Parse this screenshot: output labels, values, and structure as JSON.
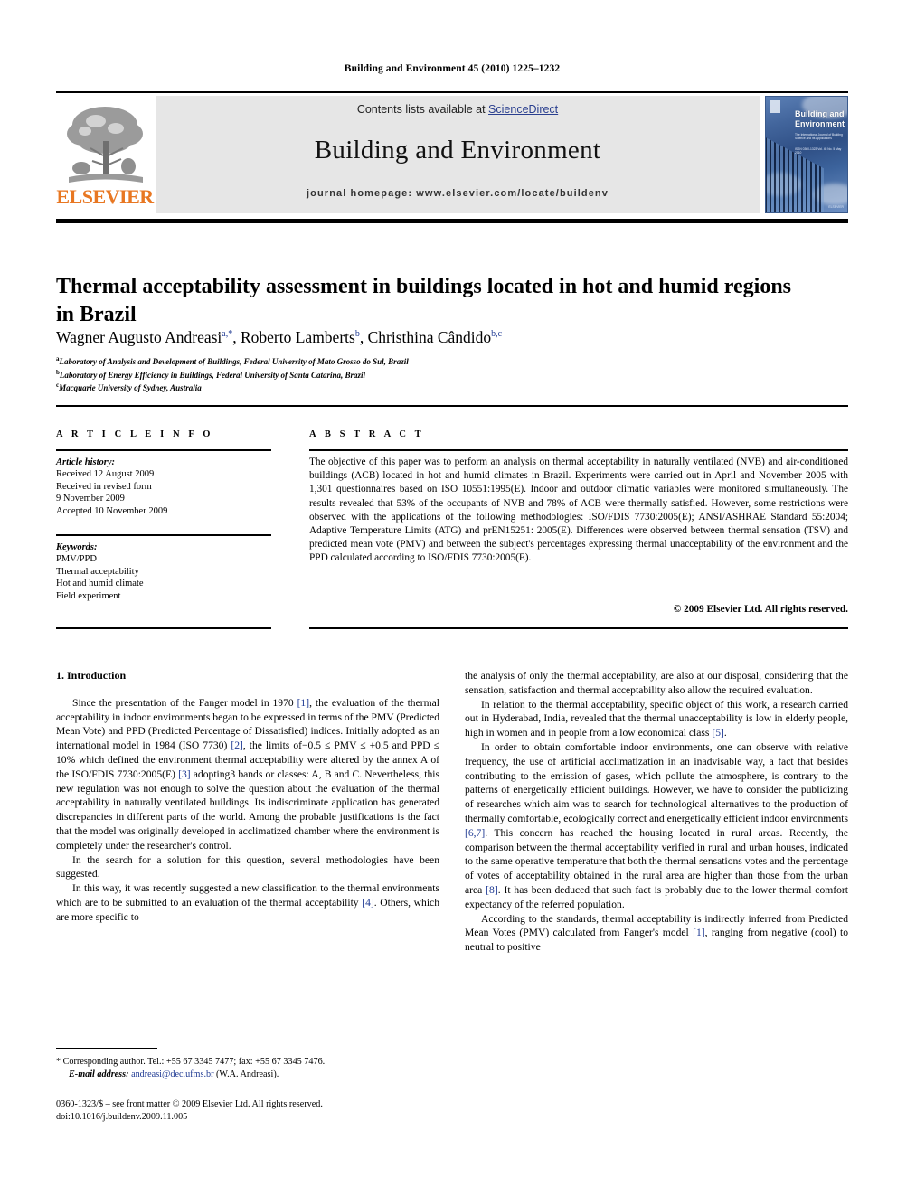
{
  "running_head": "Building and Environment 45 (2010) 1225–1232",
  "masthead": {
    "contents_prefix": "Contents lists available at ",
    "sciencedirect": "ScienceDirect",
    "journal_title": "Building and Environment",
    "homepage": "journal homepage: www.elsevier.com/locate/buildenv",
    "publisher": "ELSEVIER",
    "cover": {
      "title": "Building and Environment",
      "subtitle": "The International Journal of Building Science and its Applications",
      "issue_line": "ISSN 0360-1323  Vol. 45  No. 5  May 2010",
      "publisher": "ELSEVIER"
    }
  },
  "article": {
    "title": "Thermal acceptability assessment in buildings located in hot and humid regions in Brazil",
    "authors": [
      {
        "name": "Wagner Augusto Andreasi",
        "marks": "a,*"
      },
      {
        "name": "Roberto Lamberts",
        "marks": "b"
      },
      {
        "name": "Christhina Cândido",
        "marks": "b,c"
      }
    ],
    "affiliations": [
      {
        "mark": "a",
        "text": "Laboratory of Analysis and Development of Buildings, Federal University of Mato Grosso do Sul, Brazil"
      },
      {
        "mark": "b",
        "text": "Laboratory of Energy Efficiency in Buildings, Federal University of Santa Catarina, Brazil"
      },
      {
        "mark": "c",
        "text": "Macquarie University of Sydney, Australia"
      }
    ]
  },
  "info": {
    "label": "A R T I C L E   I N F O",
    "history_heading": "Article history:",
    "history": [
      "Received 12 August 2009",
      "Received in revised form",
      "9 November 2009",
      "Accepted 10 November 2009"
    ],
    "keywords_heading": "Keywords:",
    "keywords": [
      "PMV/PPD",
      "Thermal acceptability",
      "Hot and humid climate",
      "Field experiment"
    ]
  },
  "abstract": {
    "label": "A B S T R A C T",
    "text": "The objective of this paper was to perform an analysis on thermal acceptability in naturally ventilated (NVB) and air-conditioned buildings (ACB) located in hot and humid climates in Brazil. Experiments were carried out in April and November 2005 with 1,301 questionnaires based on ISO 10551:1995(E). Indoor and outdoor climatic variables were monitored simultaneously. The results revealed that 53% of the occupants of NVB and 78% of ACB were thermally satisfied. However, some restrictions were observed with the applications of the following methodologies: ISO/FDIS 7730:2005(E); ANSI/ASHRAE Standard 55:2004; Adaptive Temperature Limits (ATG) and prEN15251: 2005(E). Differences were observed between thermal sensation (TSV) and predicted mean vote (PMV) and between the subject's percentages expressing thermal unacceptability of the environment and the PPD calculated according to ISO/FDIS 7730:2005(E).",
    "copyright": "© 2009 Elsevier Ltd. All rights reserved."
  },
  "body": {
    "section_heading": "1. Introduction",
    "left_paragraphs": [
      "Since the presentation of the Fanger model in 1970 [1], the evaluation of the thermal acceptability in indoor environments began to be expressed in terms of the PMV (Predicted Mean Vote) and PPD (Predicted Percentage of Dissatisfied) indices. Initially adopted as an international model in 1984 (ISO 7730) [2], the limits of−0.5 ≤ PMV ≤ +0.5 and PPD ≤ 10% which defined the environment thermal acceptability were altered by the annex A of the ISO/FDIS 7730:2005(E) [3] adopting3 bands or classes: A, B and C. Nevertheless, this new regulation was not enough to solve the question about the evaluation of the thermal acceptability in naturally ventilated buildings. Its indiscriminate application has generated discrepancies in different parts of the world. Among the probable justifications is the fact that the model was originally developed in acclimatized chamber where the environment is completely under the researcher's control.",
      "In the search for a solution for this question, several methodologies have been suggested.",
      "In this way, it was recently suggested a new classification to the thermal environments which are to be submitted to an evaluation of the thermal acceptability [4]. Others, which are more specific to"
    ],
    "right_paragraphs": [
      "the analysis of only the thermal acceptability, are also at our disposal, considering that the sensation, satisfaction and thermal acceptability also allow the required evaluation.",
      "In relation to the thermal acceptability, specific object of this work, a research carried out in Hyderabad, India, revealed that the thermal unacceptability is low in elderly people, high in women and in people from a low economical class [5].",
      "In order to obtain comfortable indoor environments, one can observe with relative frequency, the use of artificial acclimatization in an inadvisable way, a fact that besides contributing to the emission of gases, which pollute the atmosphere, is contrary to the patterns of energetically efficient buildings. However, we have to consider the publicizing of researches which aim was to search for technological alternatives to the production of thermally comfortable, ecologically correct and energetically efficient indoor environments [6,7]. This concern has reached the housing located in rural areas. Recently, the comparison between the thermal acceptability verified in rural and urban houses, indicated to the same operative temperature that both the thermal sensations votes and the percentage of votes of acceptability obtained in the rural area are higher than those from the urban area [8]. It has been deduced that such fact is probably due to the lower thermal comfort expectancy of the referred population.",
      "According to the standards, thermal acceptability is indirectly inferred from Predicted Mean Votes (PMV) calculated from Fanger's model [1], ranging from negative (cool) to neutral to positive"
    ]
  },
  "footnote": {
    "corresponding": "* Corresponding author. Tel.: +55 67 3345 7477; fax: +55 67 3345 7476.",
    "email_label": "E-mail address:",
    "email": "andreasi@dec.ufms.br",
    "email_suffix": "(W.A. Andreasi)."
  },
  "imprint": {
    "line1": "0360-1323/$ – see front matter © 2009 Elsevier Ltd. All rights reserved.",
    "line2": "doi:10.1016/j.buildenv.2009.11.005"
  },
  "colors": {
    "link": "#1f3a93",
    "elsevier_orange": "#e87722",
    "masthead_grey": "#e6e6e6"
  }
}
